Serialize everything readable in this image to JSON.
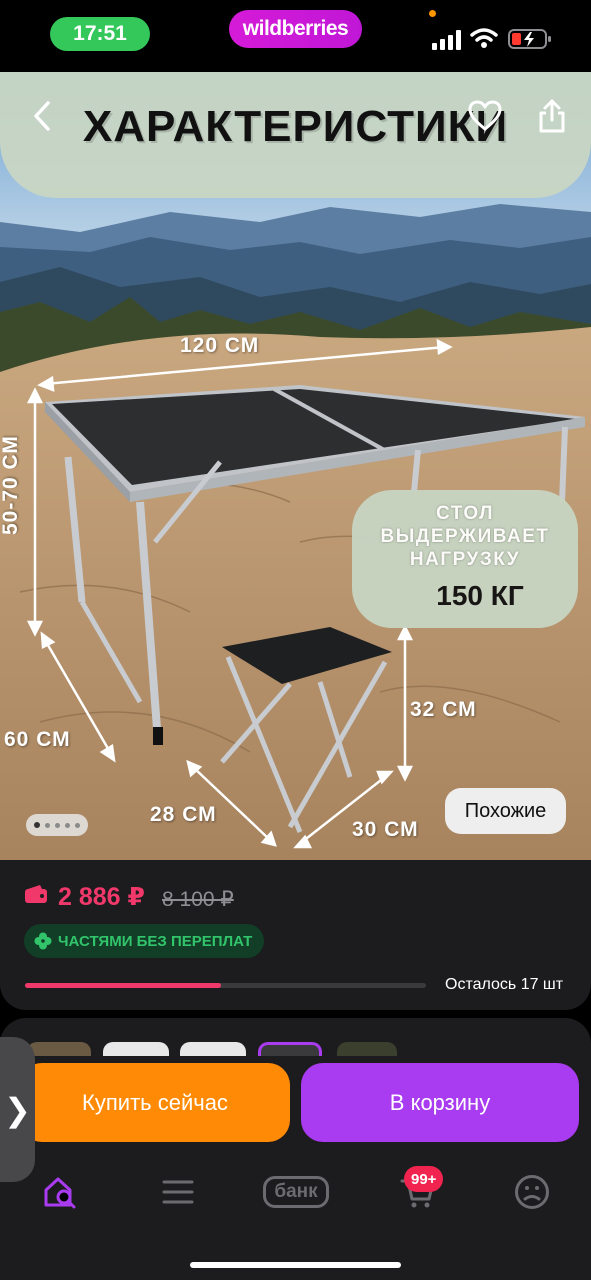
{
  "status_bar": {
    "time": "17:51",
    "app_badge": "wildberries",
    "icons": [
      "signal-icon",
      "wifi-icon",
      "battery-charging-icon"
    ],
    "colors": {
      "time_pill": "#34c759",
      "app_badge": "#cc1ad7",
      "battery_low": "#ff3b30"
    }
  },
  "product_image": {
    "banner_title": "ХАРАКТЕРИСТИКИ",
    "nav_icons": [
      "back-chevron-icon",
      "heart-icon",
      "share-icon"
    ],
    "dimensions": {
      "table_length": "120 СМ",
      "table_height": "50-70 СМ",
      "table_width": "60 СМ",
      "stool_height": "32 СМ",
      "stool_depth": "28 СМ",
      "stool_width": "30 СМ"
    },
    "load_bubble": {
      "line1": "СТОЛ",
      "line2": "ВЫДЕРЖИВАЕТ",
      "line3": "НАГРУЗКУ",
      "value": "150 КГ"
    },
    "gallery": {
      "dot_count": 5,
      "active_index": 0
    },
    "similar_button": "Похожие"
  },
  "price": {
    "current": "2 886 ₽",
    "old": "8 100 ₽",
    "installment_label": "ЧАСТЯМИ БЕЗ ПЕРЕПЛАТ",
    "stock_fraction": 0.49,
    "remaining_label": "Осталось 17 шт",
    "colors": {
      "price": "#f0386b",
      "installment_text": "#31c46b",
      "installment_bg": "#123d27"
    }
  },
  "actions": {
    "buy_now": "Купить сейчас",
    "add_to_cart": "В корзину",
    "side_tab_glyph": "❯",
    "colors": {
      "buy_now": "#ff8a06",
      "add_to_cart": "#a93bf0"
    }
  },
  "tab_bar": {
    "items": [
      {
        "icon": "home-search-icon",
        "active": true
      },
      {
        "icon": "menu-icon",
        "active": false
      },
      {
        "icon": "bank-icon",
        "label": "банк",
        "active": false
      },
      {
        "icon": "cart-icon",
        "badge": "99+",
        "active": false
      },
      {
        "icon": "profile-icon",
        "active": false
      }
    ],
    "active_color": "#a93bf0"
  }
}
